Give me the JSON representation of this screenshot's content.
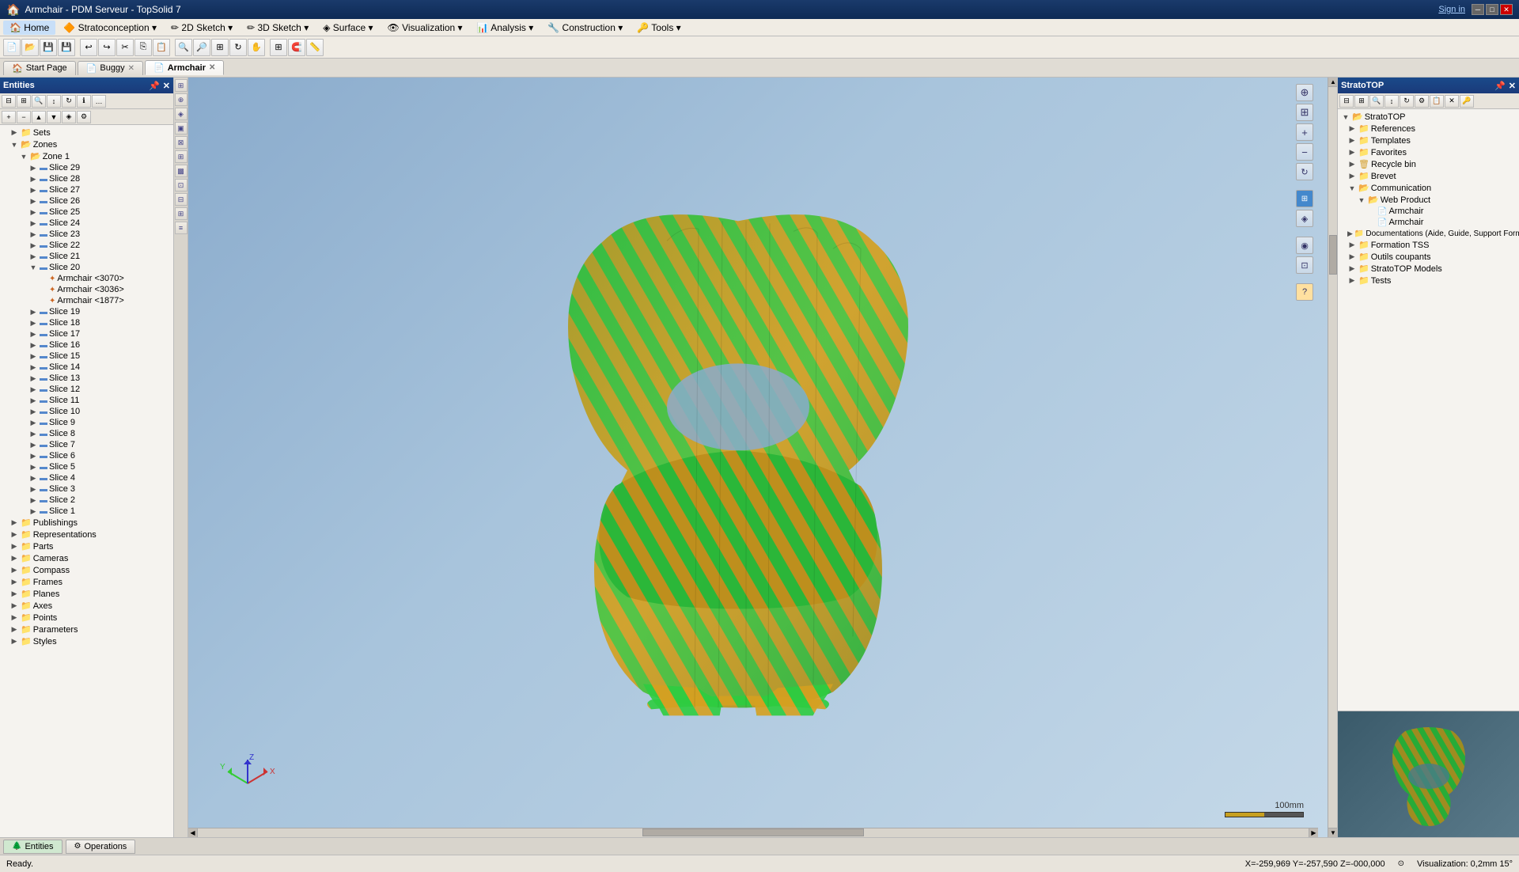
{
  "titlebar": {
    "title": "Armchair - PDM Serveur                            - TopSolid 7",
    "sign_in": "Sign in",
    "controls": [
      "─",
      "□",
      "✕"
    ]
  },
  "menu": {
    "items": [
      "Home",
      "Stratoconception",
      "2D Sketch",
      "3D Sketch",
      "Surface",
      "Visualization",
      "Analysis",
      "Construction",
      "Tools"
    ]
  },
  "tabs": {
    "items": [
      "Start Page",
      "Buggy",
      "Armchair"
    ]
  },
  "left_panel": {
    "title": "Entities",
    "tree": {
      "items": [
        {
          "label": "Sets",
          "level": 1,
          "icon": "folder",
          "expanded": false
        },
        {
          "label": "Zones",
          "level": 1,
          "icon": "folder",
          "expanded": true
        },
        {
          "label": "Zone 1",
          "level": 2,
          "icon": "folder-blue",
          "expanded": true
        },
        {
          "label": "Slice 29",
          "level": 3,
          "icon": "slice",
          "expanded": false
        },
        {
          "label": "Slice 28",
          "level": 3,
          "icon": "slice",
          "expanded": false
        },
        {
          "label": "Slice 27",
          "level": 3,
          "icon": "slice",
          "expanded": false
        },
        {
          "label": "Slice 26",
          "level": 3,
          "icon": "slice",
          "expanded": false
        },
        {
          "label": "Slice 25",
          "level": 3,
          "icon": "slice",
          "expanded": false
        },
        {
          "label": "Slice 24",
          "level": 3,
          "icon": "slice",
          "expanded": false
        },
        {
          "label": "Slice 23",
          "level": 3,
          "icon": "slice",
          "expanded": false
        },
        {
          "label": "Slice 22",
          "level": 3,
          "icon": "slice",
          "expanded": false
        },
        {
          "label": "Slice 21",
          "level": 3,
          "icon": "slice",
          "expanded": false
        },
        {
          "label": "Slice 20",
          "level": 3,
          "icon": "slice",
          "expanded": true
        },
        {
          "label": "Armchair <3070>",
          "level": 4,
          "icon": "part"
        },
        {
          "label": "Armchair <3036>",
          "level": 4,
          "icon": "part"
        },
        {
          "label": "Armchair <1877>",
          "level": 4,
          "icon": "part"
        },
        {
          "label": "Slice 19",
          "level": 3,
          "icon": "slice",
          "expanded": false
        },
        {
          "label": "Slice 18",
          "level": 3,
          "icon": "slice",
          "expanded": false
        },
        {
          "label": "Slice 17",
          "level": 3,
          "icon": "slice",
          "expanded": false
        },
        {
          "label": "Slice 16",
          "level": 3,
          "icon": "slice",
          "expanded": false
        },
        {
          "label": "Slice 15",
          "level": 3,
          "icon": "slice",
          "expanded": false
        },
        {
          "label": "Slice 14",
          "level": 3,
          "icon": "slice",
          "expanded": false
        },
        {
          "label": "Slice 13",
          "level": 3,
          "icon": "slice",
          "expanded": false
        },
        {
          "label": "Slice 12",
          "level": 3,
          "icon": "slice",
          "expanded": false
        },
        {
          "label": "Slice 11",
          "level": 3,
          "icon": "slice",
          "expanded": false
        },
        {
          "label": "Slice 10",
          "level": 3,
          "icon": "slice",
          "expanded": false
        },
        {
          "label": "Slice 9",
          "level": 3,
          "icon": "slice",
          "expanded": false
        },
        {
          "label": "Slice 8",
          "level": 3,
          "icon": "slice",
          "expanded": false
        },
        {
          "label": "Slice 7",
          "level": 3,
          "icon": "slice",
          "expanded": false
        },
        {
          "label": "Slice 6",
          "level": 3,
          "icon": "slice",
          "expanded": false
        },
        {
          "label": "Slice 5",
          "level": 3,
          "icon": "slice",
          "expanded": false
        },
        {
          "label": "Slice 4",
          "level": 3,
          "icon": "slice",
          "expanded": false
        },
        {
          "label": "Slice 3",
          "level": 3,
          "icon": "slice",
          "expanded": false
        },
        {
          "label": "Slice 2",
          "level": 3,
          "icon": "slice",
          "expanded": false
        },
        {
          "label": "Slice 1",
          "level": 3,
          "icon": "slice",
          "expanded": false
        },
        {
          "label": "Publishings",
          "level": 1,
          "icon": "folder"
        },
        {
          "label": "Representations",
          "level": 1,
          "icon": "folder"
        },
        {
          "label": "Parts",
          "level": 1,
          "icon": "folder"
        },
        {
          "label": "Cameras",
          "level": 1,
          "icon": "folder"
        },
        {
          "label": "Compass",
          "level": 1,
          "icon": "folder"
        },
        {
          "label": "Frames",
          "level": 1,
          "icon": "folder"
        },
        {
          "label": "Planes",
          "level": 1,
          "icon": "folder"
        },
        {
          "label": "Axes",
          "level": 1,
          "icon": "folder"
        },
        {
          "label": "Points",
          "level": 1,
          "icon": "folder"
        },
        {
          "label": "Parameters",
          "level": 1,
          "icon": "folder"
        },
        {
          "label": "Styles",
          "level": 1,
          "icon": "folder"
        }
      ]
    }
  },
  "bottom_tabs": {
    "entities_label": "Entities",
    "operations_label": "Operations"
  },
  "status": {
    "ready": "Ready.",
    "coordinates": "X=-259,969  Y=-257,590  Z=-000,000",
    "visualization": "Visualization: 0,2mm 15°",
    "scale": "100mm"
  },
  "right_panel": {
    "title": "StratoTOP",
    "tree": {
      "items": [
        {
          "label": "StratoTOP",
          "level": 0,
          "icon": "folder",
          "expanded": true
        },
        {
          "label": "References",
          "level": 1,
          "icon": "folder"
        },
        {
          "label": "Templates",
          "level": 1,
          "icon": "folder"
        },
        {
          "label": "Favorites",
          "level": 1,
          "icon": "folder"
        },
        {
          "label": "Recycle bin",
          "level": 1,
          "icon": "folder"
        },
        {
          "label": "Brevet",
          "level": 1,
          "icon": "folder"
        },
        {
          "label": "Communication",
          "level": 1,
          "icon": "folder",
          "expanded": true
        },
        {
          "label": "Web Product",
          "level": 2,
          "icon": "folder",
          "expanded": true
        },
        {
          "label": "Armchair",
          "level": 3,
          "icon": "doc"
        },
        {
          "label": "Armchair",
          "level": 3,
          "icon": "doc"
        },
        {
          "label": "Documentations (Aide, Guide, Support Formatia)",
          "level": 1,
          "icon": "folder"
        },
        {
          "label": "Formation TSS",
          "level": 1,
          "icon": "folder"
        },
        {
          "label": "Outils coupants",
          "level": 1,
          "icon": "folder"
        },
        {
          "label": "StratoTOP Models",
          "level": 1,
          "icon": "folder"
        },
        {
          "label": "Tests",
          "level": 1,
          "icon": "folder"
        }
      ]
    }
  }
}
